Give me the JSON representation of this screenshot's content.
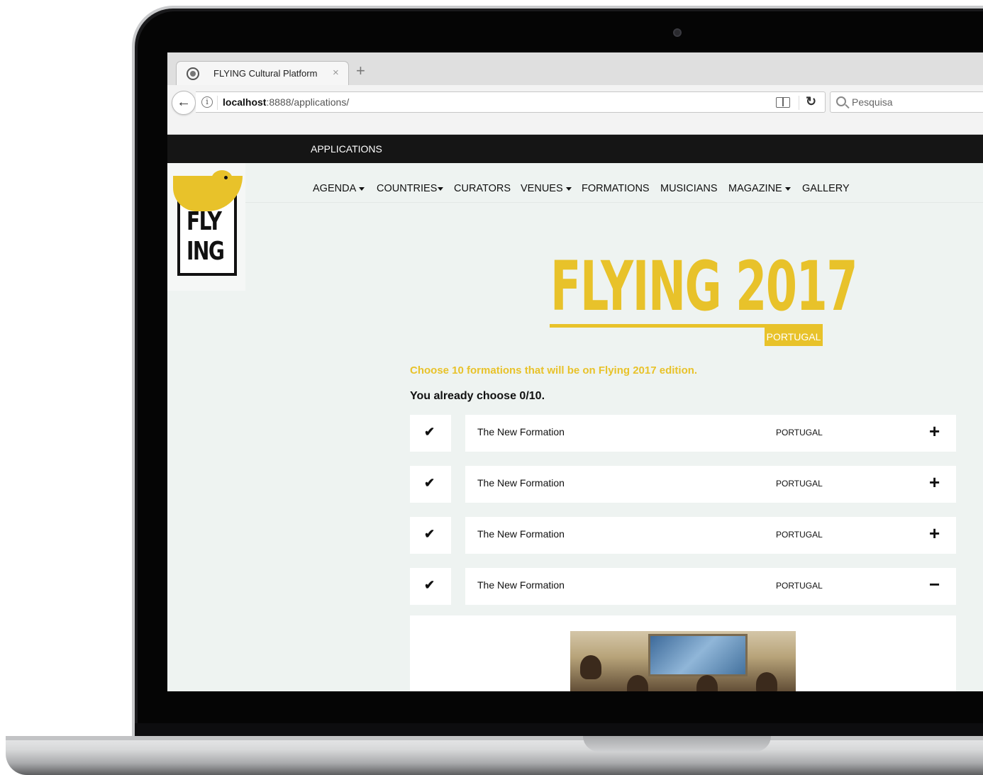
{
  "browser": {
    "tab_title": "FLYING Cultural Platform",
    "tab_close": "×",
    "new_tab": "+",
    "url_host": "localhost",
    "url_path": ":8888/applications/",
    "search_placeholder": "Pesquisa"
  },
  "site": {
    "topbar_link": "APPLICATIONS",
    "logo_line1": "FLY",
    "logo_line2": "ING",
    "nav": [
      {
        "label": "AGENDA",
        "dropdown": true
      },
      {
        "label": "COUNTRIES",
        "dropdown": true
      },
      {
        "label": "CURATORS",
        "dropdown": false
      },
      {
        "label": "VENUES",
        "dropdown": true
      },
      {
        "label": "FORMATIONS",
        "dropdown": false
      },
      {
        "label": "MUSICIANS",
        "dropdown": false
      },
      {
        "label": "MAGAZINE",
        "dropdown": true
      },
      {
        "label": "GALLERY",
        "dropdown": false
      }
    ]
  },
  "hero": {
    "title": "FLYING 2017",
    "badge": "PORTUGAL"
  },
  "selection": {
    "instruction": "Choose 10 formations that will be on Flying 2017 edition.",
    "progress": "You already choose 0/10."
  },
  "formations": [
    {
      "name": "The New Formation",
      "country": "PORTUGAL",
      "toggle": "+"
    },
    {
      "name": "The New Formation",
      "country": "PORTUGAL",
      "toggle": "+"
    },
    {
      "name": "The New Formation",
      "country": "PORTUGAL",
      "toggle": "+"
    },
    {
      "name": "The New Formation",
      "country": "PORTUGAL",
      "toggle": "−"
    }
  ],
  "colors": {
    "accent": "#e8c22a",
    "topbar": "#151515",
    "page_bg": "#eef3f1"
  }
}
